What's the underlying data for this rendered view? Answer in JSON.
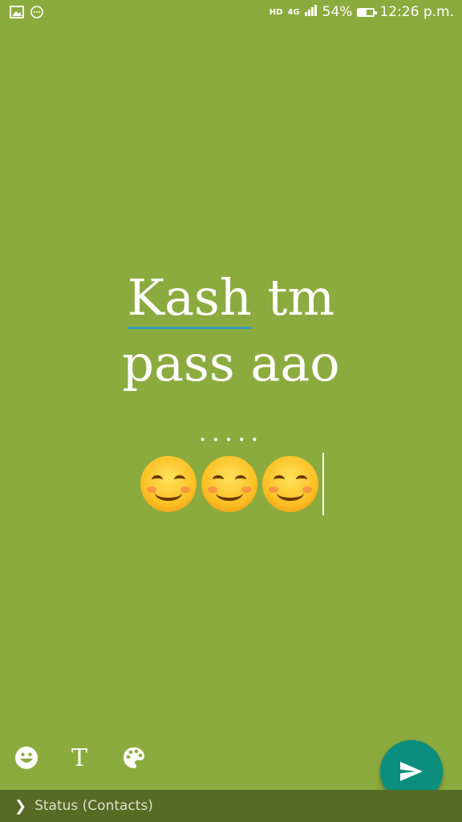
{
  "status_bar": {
    "network": "4G",
    "hd_badge": "HD",
    "battery_percent": "54%",
    "battery_level": 0.54,
    "time": "12:26 p.m.",
    "icons": [
      "gallery-icon",
      "message-icon",
      "hd-icon",
      "signal-icon",
      "battery-icon"
    ]
  },
  "editor": {
    "word_underlined": "Kash",
    "line1_rest": " tm",
    "line2": "pass aao",
    "dots": ".....",
    "emoji_count": 3,
    "emoji_name": "smiling-face-with-smiling-eyes"
  },
  "toolbar": {
    "emoji_icon": "smiley-icon",
    "text_label": "T",
    "palette_icon": "palette-icon"
  },
  "send_button": {
    "icon": "send-icon",
    "color": "#0b8e7d"
  },
  "bottom_bar": {
    "recipient_label": "Status (Contacts)"
  },
  "colors": {
    "background": "#8cab3f",
    "bottom_bar": "#566b26",
    "underline": "#3a9fbf"
  }
}
